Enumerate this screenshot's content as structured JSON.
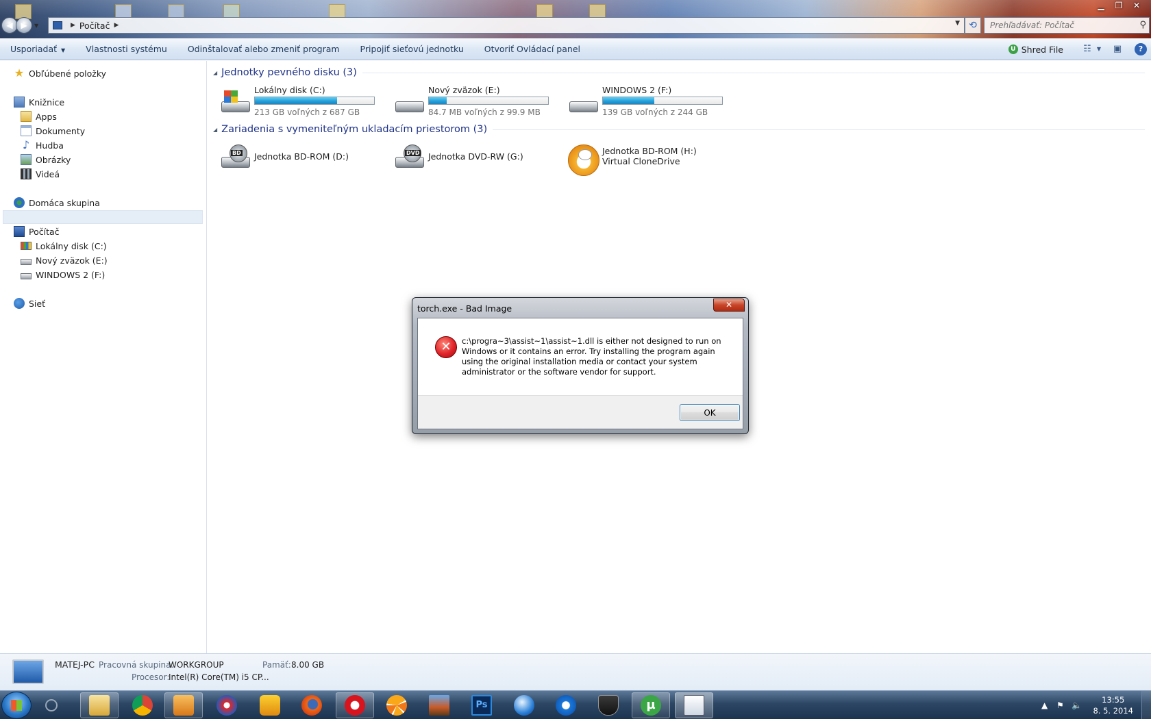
{
  "window": {
    "breadcrumb": [
      "Počítač"
    ],
    "search_placeholder": "Prehľadávať: Počítač"
  },
  "toolbar": {
    "organize": "Usporiadať",
    "system_properties": "Vlastnosti systému",
    "uninstall": "Odinštalovať alebo zmeniť program",
    "map_drive": "Pripojiť sieťovú jednotku",
    "control_panel": "Otvoriť Ovládací panel",
    "shred_file": "Shred File"
  },
  "sidebar": {
    "favorites": "Obľúbené položky",
    "libraries": "Knižnice",
    "library_items": [
      "Apps",
      "Dokumenty",
      "Hudba",
      "Obrázky",
      "Videá"
    ],
    "homegroup": "Domáca skupina",
    "computer": "Počítač",
    "computer_items": [
      "Lokálny disk (C:)",
      "Nový zväzok (E:)",
      "WINDOWS 2 (F:)"
    ],
    "network": "Sieť"
  },
  "groups": {
    "hdd_title": "Jednotky pevného disku (3)",
    "removable_title": "Zariadenia s vymeniteľným ukladacím priestorom (3)"
  },
  "hard_drives": [
    {
      "name": "Lokálny disk (C:)",
      "free_text": "213 GB voľných z 687 GB",
      "used_fraction": 0.69
    },
    {
      "name": "Nový zväzok (E:)",
      "free_text": "84.7 MB voľných z 99.9 MB",
      "used_fraction": 0.15
    },
    {
      "name": "WINDOWS 2 (F:)",
      "free_text": "139 GB voľných z 244 GB",
      "used_fraction": 0.43
    }
  ],
  "removable": [
    {
      "name": "Jednotka BD-ROM (D:)",
      "badge": "BD"
    },
    {
      "name": "Jednotka DVD-RW (G:)",
      "badge": "DVD"
    },
    {
      "name": "Jednotka BD-ROM (H:) Virtual CloneDrive",
      "badge": ""
    }
  ],
  "details": {
    "computer_name": "MATEJ-PC",
    "workgroup_label": "Pracovná skupina:",
    "workgroup_value": "WORKGROUP",
    "memory_label": "Pamäť:",
    "memory_value": "8.00 GB",
    "processor_label": "Procesor:",
    "processor_value": "Intel(R) Core(TM) i5 CP..."
  },
  "dialog": {
    "title": "torch.exe - Bad Image",
    "message": "c:\\progra~3\\assist~1\\assist~1.dll is either not designed to run on Windows or it contains an error. Try installing the program again using the original installation media or contact your system administrator or the software vendor for support.",
    "ok": "OK"
  },
  "taskbar": {
    "time": "13:55",
    "date": "8. 5. 2014",
    "pinned": [
      "explorer-icon",
      "chrome-icon",
      "media-player-icon",
      "app-icon-red",
      "app-icon-yellow",
      "firefox-icon",
      "opera-icon",
      "app-icon-orange",
      "game-icon",
      "photoshop-icon",
      "app-icon-blue",
      "ccleaner-icon",
      "shield-app-icon",
      "utorrent-icon",
      "explorer-window-icon"
    ]
  },
  "colors": {
    "accent": "#1e3287",
    "bar_fill": "#26a0da",
    "error_red": "#e0242a"
  }
}
